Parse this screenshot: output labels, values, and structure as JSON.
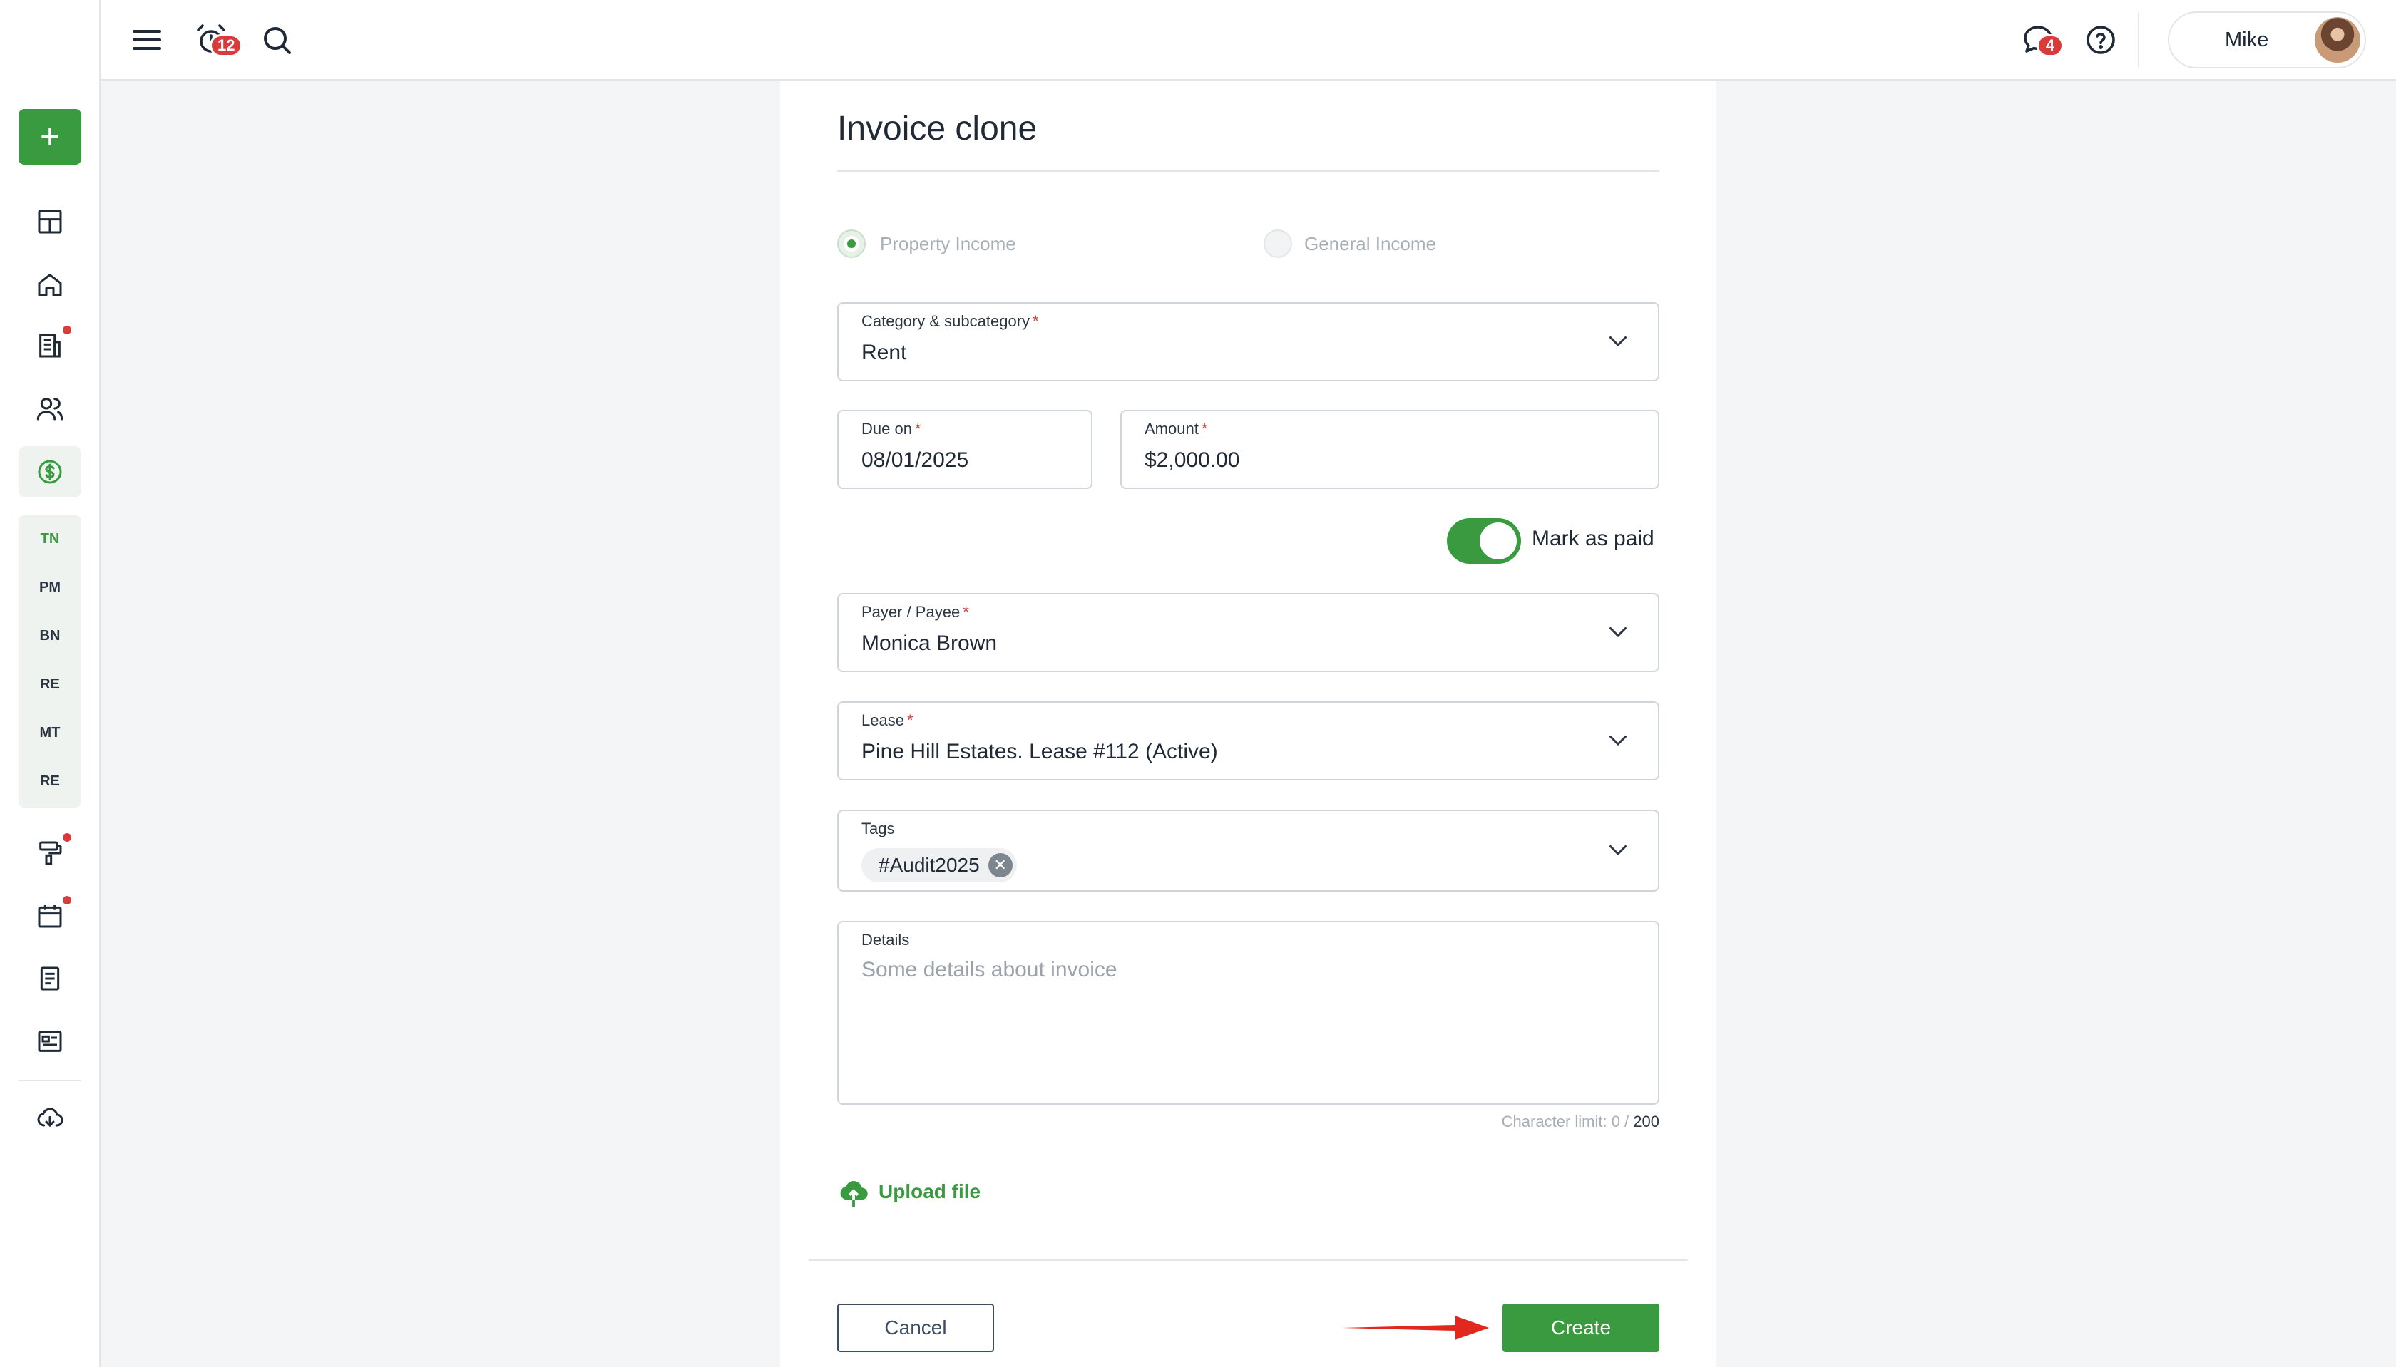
{
  "topbar": {
    "notifications_badge": "12",
    "messages_badge": "4",
    "user_name": "Mike"
  },
  "sidebar": {
    "add_label": "+",
    "sub_items": [
      "TN",
      "PM",
      "BN",
      "RE",
      "MT",
      "RE"
    ],
    "active_sub_item": "TN"
  },
  "form": {
    "title": "Invoice clone",
    "income_type": {
      "options": [
        "Property Income",
        "General Income"
      ],
      "selected": "Property Income"
    },
    "category": {
      "label": "Category & subcategory",
      "required": "*",
      "value": "Rent"
    },
    "due_on": {
      "label": "Due on",
      "required": "*",
      "value": "08/01/2025"
    },
    "amount": {
      "label": "Amount",
      "required": "*",
      "value": "$2,000.00"
    },
    "mark_as_paid": {
      "label": "Mark as paid",
      "checked": true
    },
    "payer": {
      "label": "Payer / Payee",
      "required": "*",
      "value": "Monica Brown"
    },
    "lease": {
      "label": "Lease",
      "required": "*",
      "value": "Pine Hill Estates. Lease #112 (Active)"
    },
    "tags": {
      "label": "Tags",
      "chips": [
        "#Audit2025"
      ]
    },
    "details": {
      "label": "Details",
      "placeholder": "Some details about invoice",
      "value": ""
    },
    "char_limit": {
      "prefix": "Character limit: 0 / ",
      "max": "200"
    },
    "upload_label": "Upload file",
    "cancel_label": "Cancel",
    "create_label": "Create"
  },
  "colors": {
    "accent": "#3a9a3f",
    "badge": "#d93a3a",
    "annotation_arrow": "#e0281e"
  }
}
